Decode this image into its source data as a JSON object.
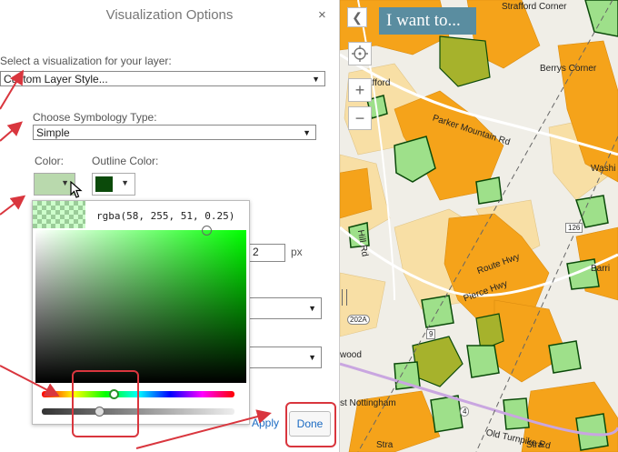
{
  "panel": {
    "title": "Visualization Options",
    "close": "×",
    "viz_label": "Select a visualization for your layer:",
    "viz_value": "Custom Layer Style...",
    "symb_label": "Choose Symbology Type:",
    "symb_value": "Simple",
    "color_label": "Color:",
    "outline_label": "Outline Color:",
    "outline_width_value": "2",
    "outline_width_unit": "px",
    "apply_label": "Apply",
    "done_label": "Done"
  },
  "picker": {
    "rgba_text": "rgba(58, 255, 51, 0.25)"
  },
  "colors": {
    "fill": "#b9d9ad",
    "outline": "#0b4a0a",
    "annotation": "#d9363e",
    "parcel_orange": "#f5a31a",
    "parcel_yellow": "#f8dfa5",
    "parcel_green": "#9ee08a",
    "parcel_olive": "#a6b22c"
  },
  "map": {
    "toolbar": {
      "back_icon": "chevron-left-icon",
      "want_label": "I want to..."
    },
    "controls": {
      "locate_icon": "crosshair-icon",
      "zoom_in": "+",
      "zoom_out": "−"
    },
    "labels": [
      "Strafford Corner",
      "Berrys Corner",
      "afford",
      "Parker Mountain Rd",
      "Washi",
      "Barri",
      "Hill Rd",
      "Route Hwy",
      "wood",
      "st Nottingham",
      "202A",
      "126",
      "Old Turnpike Rd",
      "Stra",
      "Stra",
      "9",
      "4",
      "Pierce Hwy"
    ]
  }
}
